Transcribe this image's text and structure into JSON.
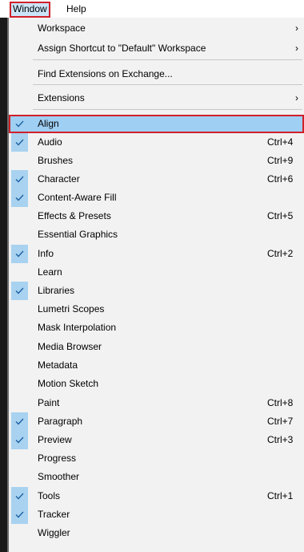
{
  "menubar": {
    "window_label": "Window",
    "help_label": "Help"
  },
  "menu": {
    "items": [
      {
        "label": "Workspace",
        "checked": false,
        "shortcut": "",
        "submenu": true
      },
      {
        "label": "Assign Shortcut to \"Default\" Workspace",
        "checked": false,
        "shortcut": "",
        "submenu": true
      },
      {
        "label": "Find Extensions on Exchange...",
        "checked": false,
        "shortcut": "",
        "submenu": false
      },
      {
        "label": "Extensions",
        "checked": false,
        "shortcut": "",
        "submenu": true
      },
      {
        "label": "Align",
        "checked": true,
        "shortcut": "",
        "submenu": false,
        "highlighted": true
      },
      {
        "label": "Audio",
        "checked": true,
        "shortcut": "Ctrl+4",
        "submenu": false
      },
      {
        "label": "Brushes",
        "checked": false,
        "shortcut": "Ctrl+9",
        "submenu": false
      },
      {
        "label": "Character",
        "checked": true,
        "shortcut": "Ctrl+6",
        "submenu": false
      },
      {
        "label": "Content-Aware Fill",
        "checked": true,
        "shortcut": "",
        "submenu": false
      },
      {
        "label": "Effects & Presets",
        "checked": false,
        "shortcut": "Ctrl+5",
        "submenu": false
      },
      {
        "label": "Essential Graphics",
        "checked": false,
        "shortcut": "",
        "submenu": false
      },
      {
        "label": "Info",
        "checked": true,
        "shortcut": "Ctrl+2",
        "submenu": false
      },
      {
        "label": "Learn",
        "checked": false,
        "shortcut": "",
        "submenu": false
      },
      {
        "label": "Libraries",
        "checked": true,
        "shortcut": "",
        "submenu": false
      },
      {
        "label": "Lumetri Scopes",
        "checked": false,
        "shortcut": "",
        "submenu": false
      },
      {
        "label": "Mask Interpolation",
        "checked": false,
        "shortcut": "",
        "submenu": false
      },
      {
        "label": "Media Browser",
        "checked": false,
        "shortcut": "",
        "submenu": false
      },
      {
        "label": "Metadata",
        "checked": false,
        "shortcut": "",
        "submenu": false
      },
      {
        "label": "Motion Sketch",
        "checked": false,
        "shortcut": "",
        "submenu": false
      },
      {
        "label": "Paint",
        "checked": false,
        "shortcut": "Ctrl+8",
        "submenu": false
      },
      {
        "label": "Paragraph",
        "checked": true,
        "shortcut": "Ctrl+7",
        "submenu": false
      },
      {
        "label": "Preview",
        "checked": true,
        "shortcut": "Ctrl+3",
        "submenu": false
      },
      {
        "label": "Progress",
        "checked": false,
        "shortcut": "",
        "submenu": false
      },
      {
        "label": "Smoother",
        "checked": false,
        "shortcut": "",
        "submenu": false
      },
      {
        "label": "Tools",
        "checked": true,
        "shortcut": "Ctrl+1",
        "submenu": false
      },
      {
        "label": "Tracker",
        "checked": true,
        "shortcut": "",
        "submenu": false
      },
      {
        "label": "Wiggler",
        "checked": false,
        "shortcut": "",
        "submenu": false
      }
    ]
  },
  "icons": {
    "check": "checkmark-icon",
    "submenu_arrow": "chevron-right-icon"
  },
  "colors": {
    "menu_background": "#f2f2f2",
    "check_background": "#a8d2f0",
    "highlight_background": "#9fcff3",
    "annotation_outline": "#d0202a",
    "menubar_active": "#cce4f7"
  }
}
